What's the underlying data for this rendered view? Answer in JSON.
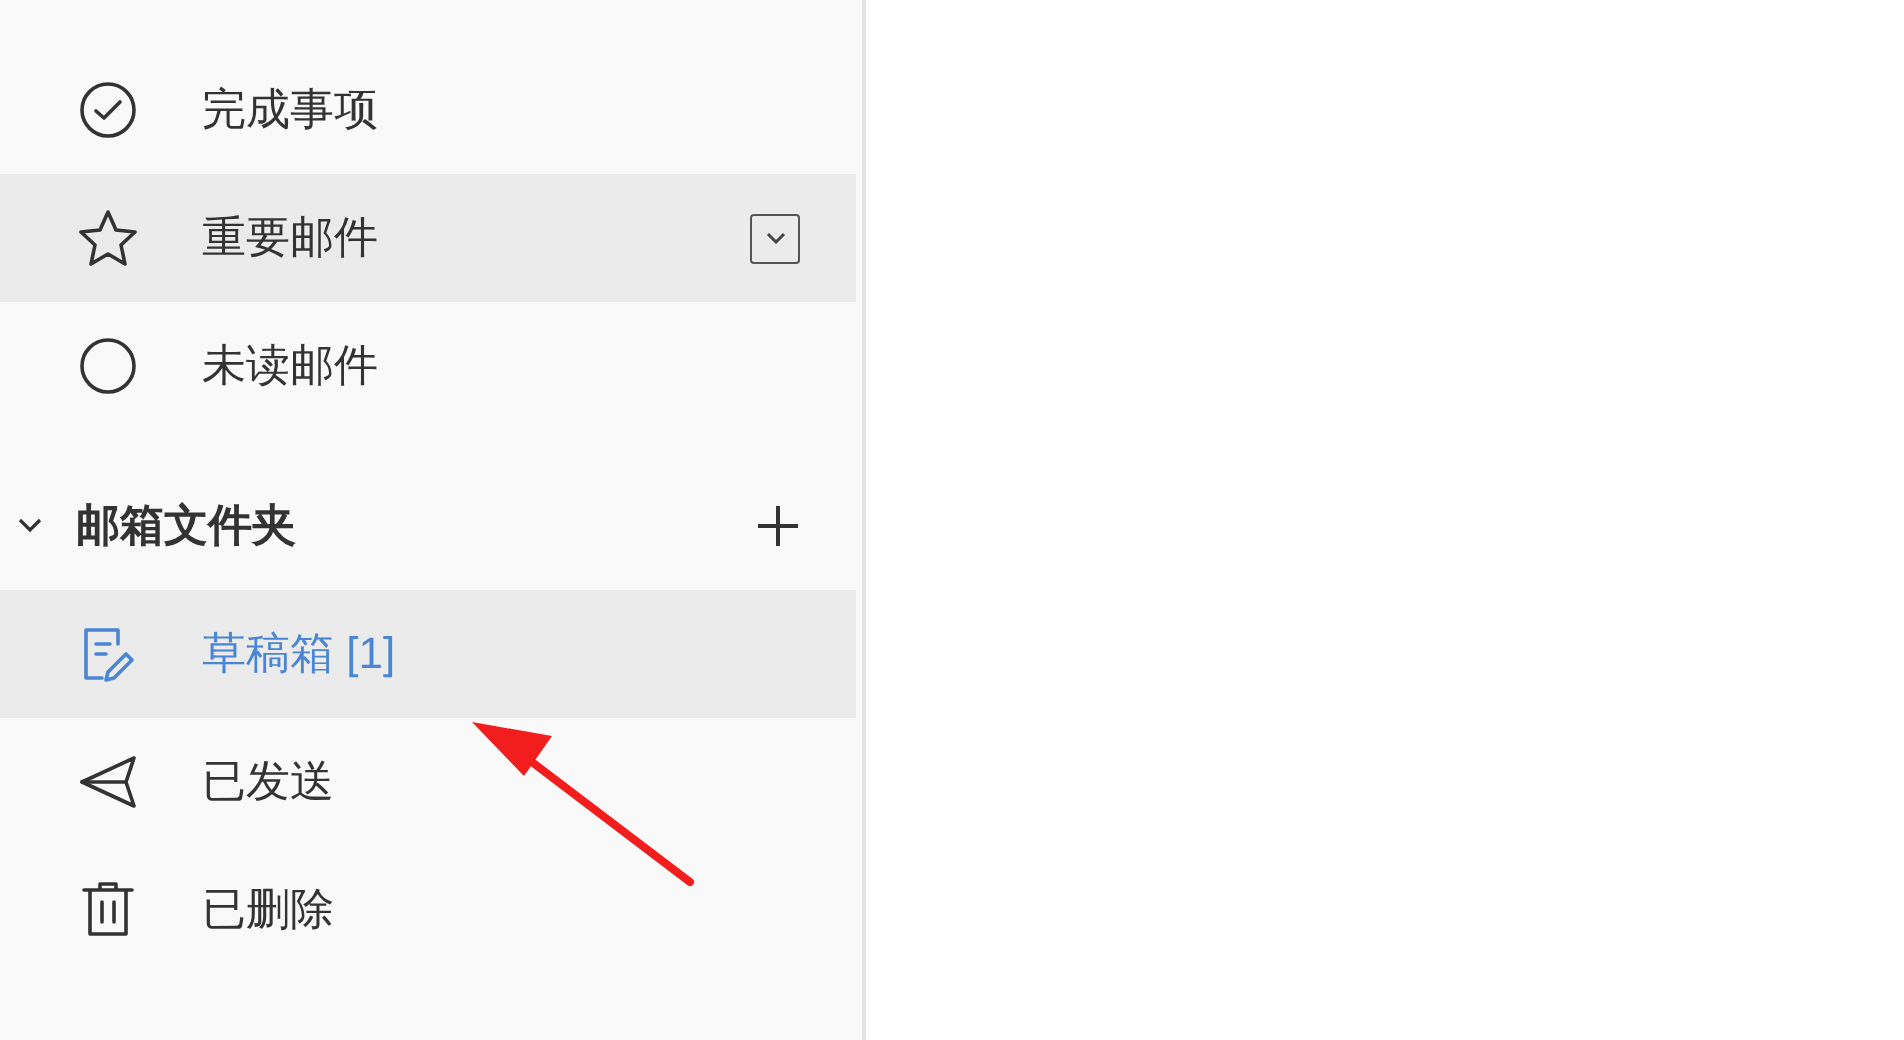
{
  "smart_folders": [
    {
      "label": "完成事项",
      "selected": false,
      "highlighted": false,
      "menu_button": false
    },
    {
      "label": "重要邮件",
      "selected": false,
      "highlighted": true,
      "menu_button": true
    },
    {
      "label": "未读邮件",
      "selected": false,
      "highlighted": false,
      "menu_button": false
    }
  ],
  "folder_section": {
    "title": "邮箱文件夹",
    "expanded": true
  },
  "folders": [
    {
      "label": "草稿箱 [1]",
      "selected": true,
      "highlighted": true
    },
    {
      "label": "已发送",
      "selected": false,
      "highlighted": false
    },
    {
      "label": "已删除",
      "selected": false,
      "highlighted": false
    }
  ]
}
